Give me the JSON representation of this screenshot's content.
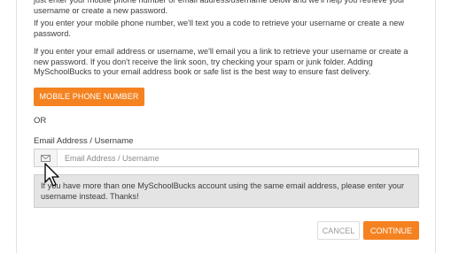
{
  "instructions": {
    "paragraph_1": "just enter your mobile phone number or email address/username below and we'll help you retrieve your username or create a new password.",
    "paragraph_2": "If you enter your mobile phone number, we'll text you a code to retrieve your username or create a new password.",
    "paragraph_3": "If you enter your email address or username, we'll email you a link to retrieve your username or create a new password. If you don't receive the link soon, try checking your spam or junk folder. Adding MySchoolBucks to your email address book or safe list is the best way to ensure fast delivery."
  },
  "phone_button": {
    "label": "MOBILE PHONE NUMBER"
  },
  "separator": {
    "label": "OR"
  },
  "email_field": {
    "label": "Email Address / Username",
    "placeholder": "Email Address / Username",
    "value": "",
    "icon": "envelope-icon"
  },
  "info_note": {
    "text": "If you have more than one MySchoolBucks account using the same email address, please enter your username instead. Thanks!"
  },
  "actions": {
    "cancel_label": "CANCEL",
    "continue_label": "CONTINUE"
  },
  "colors": {
    "accent": "#f58220",
    "info_background": "#e4e4e4",
    "text": "#3c3c3c"
  }
}
